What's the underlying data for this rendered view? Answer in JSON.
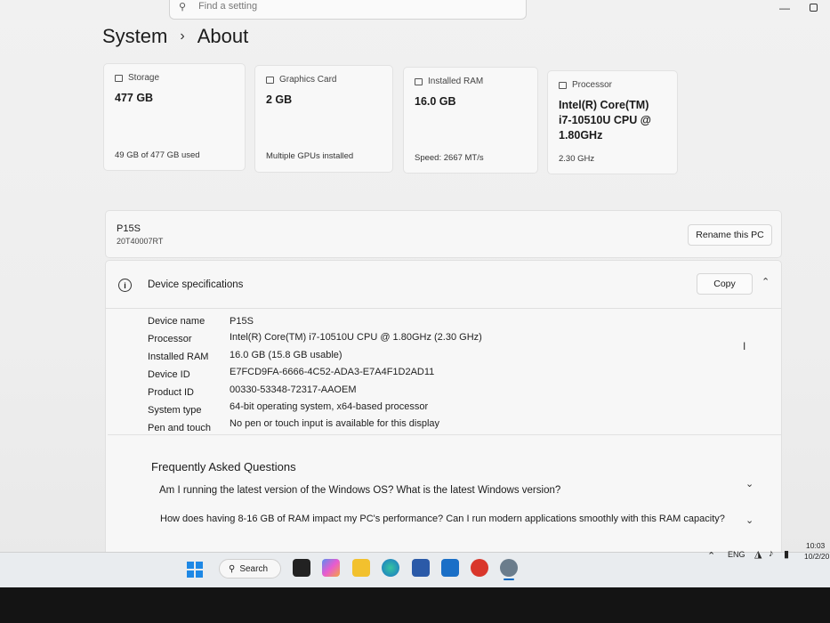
{
  "search": {
    "placeholder": "Find a setting"
  },
  "breadcrumb": {
    "parent": "System",
    "current": "About"
  },
  "cards": [
    {
      "title": "Storage",
      "value": "477 GB",
      "sub": "49 GB of 477 GB used"
    },
    {
      "title": "Graphics Card",
      "value": "2 GB",
      "sub": "Multiple GPUs installed"
    },
    {
      "title": "Installed RAM",
      "value": "16.0 GB",
      "sub": "Speed: 2667 MT/s"
    },
    {
      "title": "Processor",
      "value_lines": [
        "Intel(R) Core(TM)",
        "i7-10510U CPU @",
        "1.80GHz"
      ],
      "sub": "2.30 GHz"
    }
  ],
  "pc": {
    "name": "P15S",
    "model": "20T40007RT",
    "rename_label": "Rename this PC"
  },
  "specs": {
    "title": "Device specifications",
    "copy_label": "Copy",
    "rows": [
      {
        "label": "Device name",
        "value": "P15S"
      },
      {
        "label": "Processor",
        "value": "Intel(R) Core(TM) i7-10510U CPU @ 1.80GHz (2.30 GHz)"
      },
      {
        "label": "Installed RAM",
        "value": "16.0 GB (15.8 GB usable)"
      },
      {
        "label": "Device ID",
        "value": "E7FCD9FA-6666-4C52-ADA3-E7A4F1D2AD11"
      },
      {
        "label": "Product ID",
        "value": "00330-53348-72317-AAOEM"
      },
      {
        "label": "System type",
        "value": "64-bit operating system, x64-based processor"
      },
      {
        "label": "Pen and touch",
        "value": "No pen or touch input is available for this display"
      }
    ]
  },
  "faq": {
    "title": "Frequently Asked Questions",
    "items": [
      "Am I running the latest version of the Windows OS? What is the latest Windows version?",
      "How does having 8-16 GB of RAM impact my PC's performance? Can I run modern applications smoothly with this RAM capacity?"
    ]
  },
  "taskbar": {
    "search_label": "Search",
    "lang": "ENG",
    "time": "10:03",
    "date": "10/2/20"
  },
  "colors": {
    "accent": "#0067c0",
    "start_blue": "#1e88e5"
  }
}
